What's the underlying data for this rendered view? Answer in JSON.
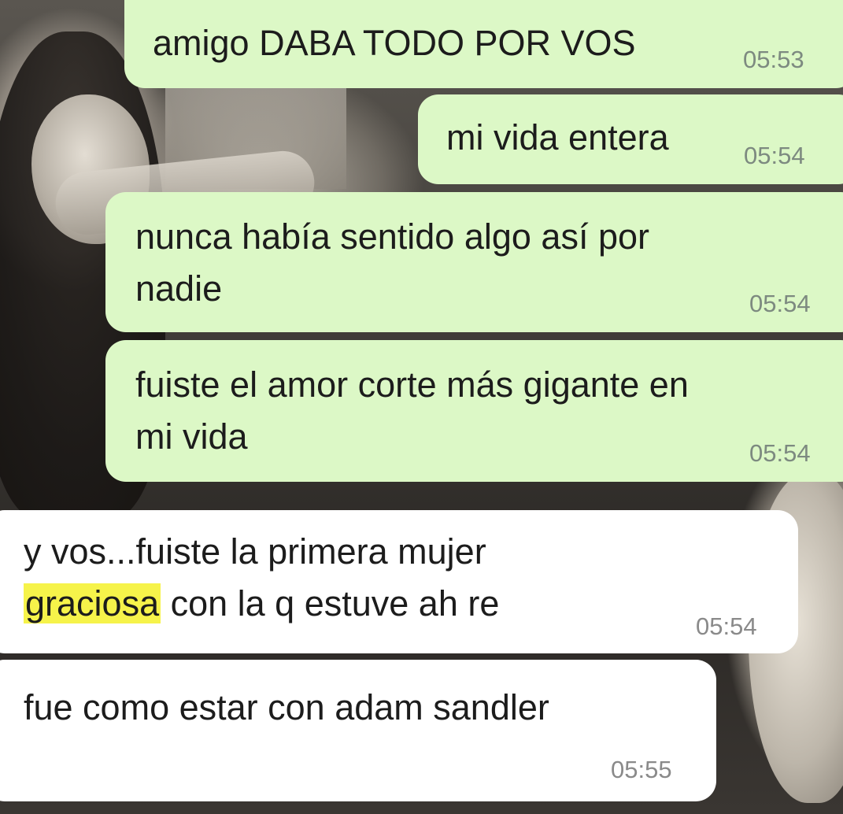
{
  "messages": [
    {
      "direction": "outgoing",
      "text": "amigo DABA TODO POR VOS",
      "time": "05:53"
    },
    {
      "direction": "outgoing",
      "text": "mi vida entera",
      "time": "05:54"
    },
    {
      "direction": "outgoing",
      "text": "nunca había sentido algo así por\nnadie",
      "time": "05:54"
    },
    {
      "direction": "outgoing",
      "text": "fuiste el amor corte más gigante en\nmi vida",
      "time": "05:54"
    },
    {
      "direction": "incoming",
      "text_line1": "y vos...fuiste la primera mujer",
      "text_highlight": "graciosa",
      "text_rest": " con la q estuve ah re",
      "time": "05:54"
    },
    {
      "direction": "incoming",
      "text": "fue como estar con adam sandler",
      "time": "05:55"
    }
  ],
  "colors": {
    "outgoing_bubble": "#dcf8c6",
    "incoming_bubble": "#ffffff",
    "highlight": "#f6f34a"
  }
}
